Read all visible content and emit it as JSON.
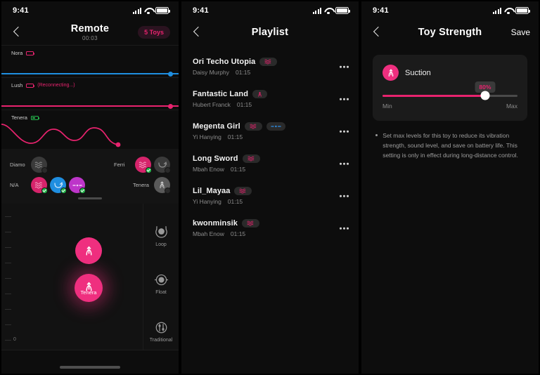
{
  "status_bar": {
    "time": "9:41",
    "signal_icon": "cellular-bars-icon",
    "wifi_icon": "wifi-icon",
    "battery_icon": "battery-icon"
  },
  "remote": {
    "nav": {
      "back_icon": "chevron-left-icon",
      "title": "Remote",
      "elapsed": "00:03",
      "toys_pill": "5 Toys"
    },
    "tracks": [
      {
        "name": "Nora",
        "battery_state": "low",
        "status": "",
        "line_color": "#1f8ee0",
        "value_pct": 97,
        "type": "line"
      },
      {
        "name": "Lush",
        "battery_state": "low",
        "status": "(Reconnecting...)",
        "line_color": "#e8236e",
        "value_pct": 97,
        "type": "line"
      },
      {
        "name": "Tenera",
        "battery_state": "ok",
        "status": "",
        "line_color": "#e8236e",
        "value_pct": 62,
        "type": "wave"
      }
    ],
    "toy_chips": [
      {
        "label": "Diamo",
        "icon": "wave-toy-icon",
        "color": "#3a3a3a",
        "connected": false
      },
      {
        "label": "Ferri",
        "icon": "wave-toy-icon",
        "color": "#d6246b",
        "connected": true
      },
      {
        "label": "",
        "icon": "loop-toy-icon",
        "color": "#3a3a3a",
        "connected": false
      },
      {
        "label": "N/A",
        "icon": "wave-toy-icon",
        "color": "#d6246b",
        "connected": true
      },
      {
        "label": "",
        "icon": "loop-toy-icon",
        "color": "#1f8ee0",
        "connected": true
      },
      {
        "label": "",
        "icon": "dash-toy-icon",
        "color": "#bd35c9",
        "connected": true
      },
      {
        "label": "Tenera",
        "icon": "suction-toy-icon",
        "color": "#5a5a5a",
        "connected": false
      }
    ],
    "modes": [
      {
        "label": "Loop",
        "icon": "loop-mode-icon"
      },
      {
        "label": "Float",
        "icon": "float-mode-icon"
      },
      {
        "label": "Traditional",
        "icon": "traditional-mode-icon"
      }
    ],
    "balls": [
      {
        "label": "",
        "icon": "suction-toy-icon",
        "active": false
      },
      {
        "label": "Tenera",
        "icon": "suction-toy-icon",
        "active": true
      }
    ],
    "axis_zero_label": "0",
    "accent_color": "#ef2f7f"
  },
  "playlist": {
    "nav": {
      "back_icon": "chevron-left-icon",
      "title": "Playlist"
    },
    "items": [
      {
        "title": "Ori Techo Utopia",
        "artist": "Daisy Murphy",
        "duration": "01:15",
        "tags": [
          "wave-tag-icon"
        ],
        "menu_icon": "more-options-icon"
      },
      {
        "title": "Fantastic Land",
        "artist": "Hubert Franck",
        "duration": "01:15",
        "tags": [
          "suction-tag-icon"
        ],
        "menu_icon": "more-options-icon"
      },
      {
        "title": "Megenta Girl",
        "artist": "Yi Hanying",
        "duration": "01:15",
        "tags": [
          "wave-tag-icon",
          "dash-tag-icon"
        ],
        "menu_icon": "more-options-icon"
      },
      {
        "title": "Long Sword",
        "artist": "Mbah Enow",
        "duration": "01:15",
        "tags": [
          "wave-tag-icon"
        ],
        "menu_icon": "more-options-icon"
      },
      {
        "title": "Lil_Mayaa",
        "artist": "Yi Hanying",
        "duration": "01:15",
        "tags": [
          "wave-tag-icon"
        ],
        "menu_icon": "more-options-icon"
      },
      {
        "title": "kwonminsik",
        "artist": "Mbah Enow",
        "duration": "01:15",
        "tags": [
          "wave-tag-icon"
        ],
        "menu_icon": "more-options-icon"
      }
    ]
  },
  "toy_strength": {
    "nav": {
      "back_icon": "chevron-left-icon",
      "title": "Toy Strength",
      "save_label": "Save"
    },
    "card": {
      "icon": "suction-toy-icon",
      "name": "Suction",
      "value_label": "80%",
      "value_pct": 80,
      "min_label": "Min",
      "max_label": "Max"
    },
    "note": "Set max levels for this toy to reduce its vibration strength, sound level, and save on battery life. This setting is only in effect during long-distance control.",
    "accent_color": "#e8236e"
  }
}
